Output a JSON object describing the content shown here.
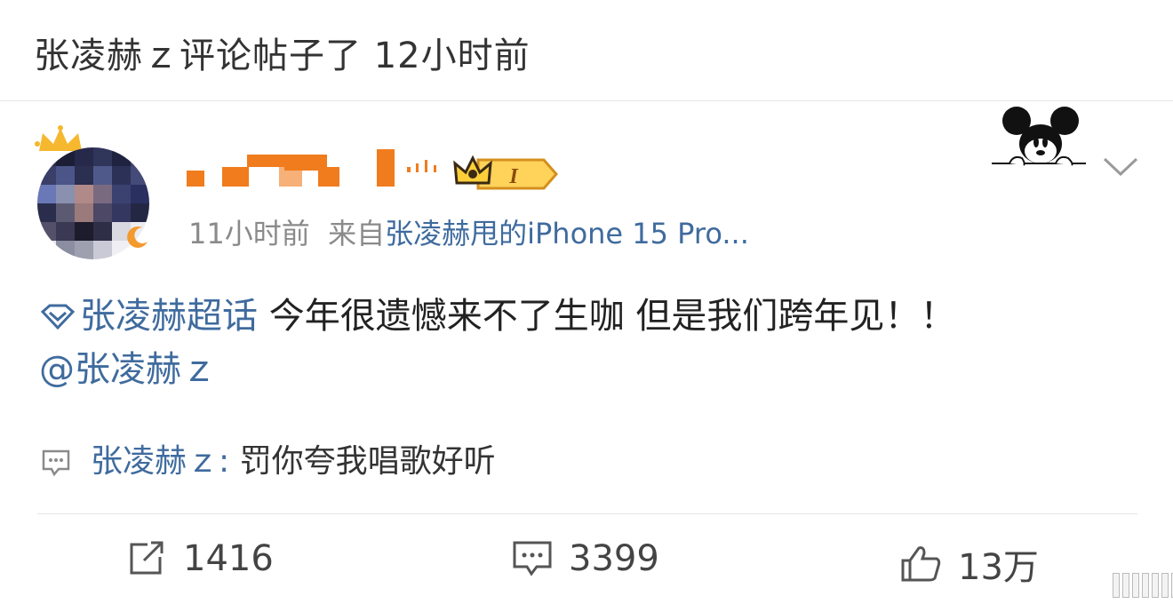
{
  "header": {
    "title": "张凌赫ｚ评论帖子了 12小时前"
  },
  "post": {
    "time": "11小时前",
    "source_prefix": "来自",
    "device": "张凌赫甩的iPhone 15 Pro...",
    "vip_level": "I",
    "topic": "张凌赫超话",
    "text": " 今年很遗憾来不了生咖 但是我们跨年见！！",
    "mention": "@张凌赫ｚ"
  },
  "comment_preview": {
    "user": "张凌赫ｚ:",
    "text": " 罚你夸我唱歌好听"
  },
  "actions": {
    "repost_count": "1416",
    "comment_count": "3399",
    "like_count": "13万"
  },
  "colors": {
    "link": "#3f6b9e",
    "username_orange": "#f07c1e",
    "crown_yellow": "#f5b82e"
  },
  "icons": [
    "crown-icon",
    "signal-icon",
    "vip-badge-icon",
    "mickey-icon",
    "chevron-down-icon",
    "topic-diamond-icon",
    "comment-icon",
    "repost-icon",
    "like-icon"
  ]
}
